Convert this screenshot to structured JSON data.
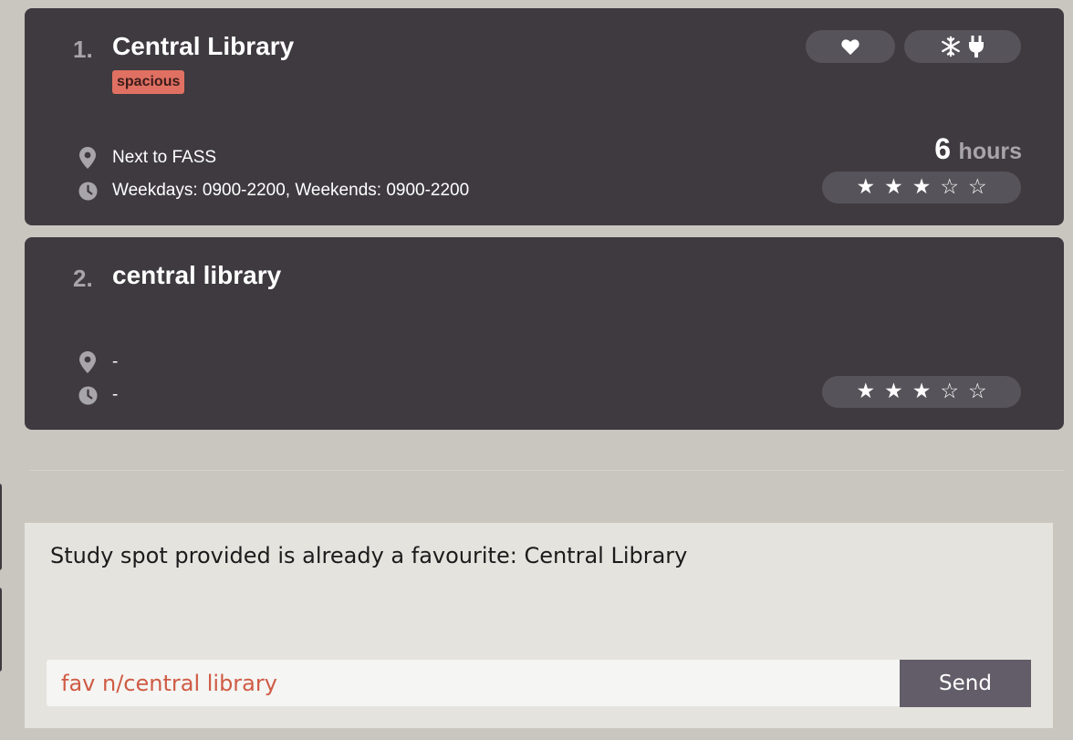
{
  "spots": [
    {
      "index": "1.",
      "name": "Central Library",
      "tags": [
        "spacious"
      ],
      "location": "Next to FASS",
      "hours_open": "Weekdays: 0900-2200, Weekends: 0900-2200",
      "study_hours_value": "6",
      "study_hours_unit": "hours",
      "rating": 3,
      "rating_max": 5,
      "favourite": true,
      "amenities": [
        "snowflake-icon",
        "plug-icon"
      ]
    },
    {
      "index": "2.",
      "name": "central library",
      "tags": [],
      "location": "-",
      "hours_open": "-",
      "rating": 3,
      "rating_max": 5,
      "favourite": false,
      "amenities": []
    }
  ],
  "result_display": {
    "message": "Study spot provided is already a favourite: Central Library"
  },
  "command_box": {
    "value": "fav n/central library",
    "send_label": "Send"
  },
  "colors": {
    "background": "#c8c6bf",
    "card": "#3e3a40",
    "pill": "#57535a",
    "tag": "#e07062",
    "command_text": "#cf5b45",
    "send_button": "#625d69"
  }
}
